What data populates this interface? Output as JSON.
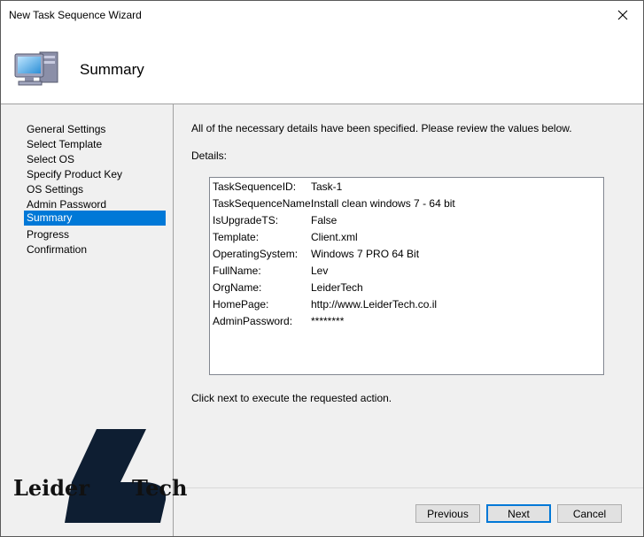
{
  "window": {
    "title": "New Task Sequence Wizard"
  },
  "header": {
    "title": "Summary",
    "icon": "computer-icon"
  },
  "sidebar": {
    "items": [
      {
        "label": "General Settings",
        "selected": false
      },
      {
        "label": "Select Template",
        "selected": false
      },
      {
        "label": "Select OS",
        "selected": false
      },
      {
        "label": "Specify Product Key",
        "selected": false
      },
      {
        "label": "OS Settings",
        "selected": false
      },
      {
        "label": "Admin Password",
        "selected": false
      },
      {
        "label": "Summary",
        "selected": true
      },
      {
        "label": "Progress",
        "selected": false
      },
      {
        "label": "Confirmation",
        "selected": false
      }
    ]
  },
  "main": {
    "intro": "All of the necessary details have been specified.  Please review the values below.",
    "details_label": "Details:",
    "details": [
      {
        "key": "TaskSequenceID:",
        "value": "Task-1"
      },
      {
        "key": "TaskSequenceName:",
        "value": "Install clean windows 7 - 64 bit"
      },
      {
        "key": "IsUpgradeTS:",
        "value": "False"
      },
      {
        "key": "Template:",
        "value": "Client.xml"
      },
      {
        "key": "OperatingSystem:",
        "value": "Windows 7 PRO 64 Bit"
      },
      {
        "key": "FullName:",
        "value": "Lev"
      },
      {
        "key": "OrgName:",
        "value": "LeiderTech"
      },
      {
        "key": "HomePage:",
        "value": "http://www.LeiderTech.co.il"
      },
      {
        "key": "AdminPassword:",
        "value": "********"
      }
    ],
    "footer_text": "Click next to execute the requested action."
  },
  "buttons": {
    "previous": "Previous",
    "next": "Next",
    "cancel": "Cancel"
  },
  "watermark": {
    "left_word": "Leider",
    "right_word": "Tech"
  },
  "colors": {
    "selection": "#0078d7",
    "panel": "#f0f0f0"
  }
}
